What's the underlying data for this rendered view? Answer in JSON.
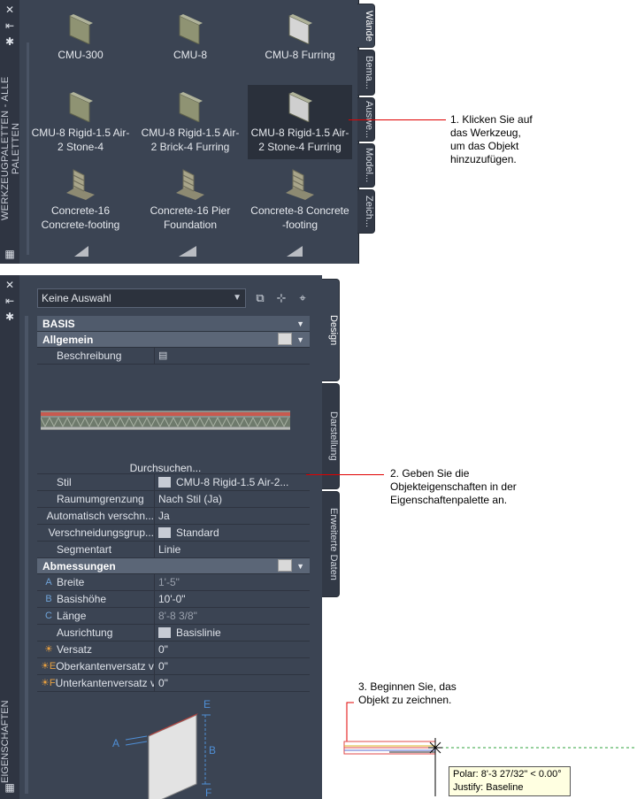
{
  "tool_palette": {
    "vertical_title": "WERKZEUGPALETTEN - ALLE PALETTEN",
    "tools": [
      {
        "label": "CMU-300"
      },
      {
        "label": "CMU-8"
      },
      {
        "label": "CMU-8 Furring"
      },
      {
        "label": "CMU-8 Rigid-1.5 Air-2 Stone-4"
      },
      {
        "label": "CMU-8 Rigid-1.5 Air-2 Brick-4 Furring"
      },
      {
        "label": "CMU-8 Rigid-1.5 Air-2 Stone-4 Furring",
        "selected": true
      },
      {
        "label": "Concrete-16 Concrete-footing"
      },
      {
        "label": "Concrete-16 Pier Foundation"
      },
      {
        "label": "Concrete-8 Concrete -footing"
      }
    ],
    "tabs": [
      "Wände",
      "Bema...",
      "Auswe...",
      "Model...",
      "Zeich..."
    ]
  },
  "properties_palette": {
    "vertical_title": "EIGENSCHAFTEN",
    "selection": "Keine Auswahl",
    "section_basis": "BASIS",
    "section_allgemein": "Allgemein",
    "beschreibung_label": "Beschreibung",
    "browse_label": "Durchsuchen...",
    "allgemein_rows": [
      {
        "key": "Stil",
        "value": "CMU-8 Rigid-1.5 Air-2..."
      },
      {
        "key": "Raumumgrenzung",
        "value": "Nach Stil (Ja)"
      },
      {
        "key": "Automatisch verschn...",
        "value": "Ja"
      },
      {
        "key": "Verschneidungsgrup...",
        "value": "Standard"
      },
      {
        "key": "Segmentart",
        "value": "Linie"
      }
    ],
    "section_abmessungen": "Abmessungen",
    "abmessungen_rows": [
      {
        "letter": "A",
        "key": "Breite",
        "value": "1'-5\"",
        "dim": true
      },
      {
        "letter": "B",
        "key": "Basishöhe",
        "value": "10'-0\"",
        "dim": false
      },
      {
        "letter": "C",
        "key": "Länge",
        "value": "8'-8 3/8\"",
        "dim": true
      },
      {
        "letter": "",
        "key": "Ausrichtung",
        "value": "Basislinie",
        "dim": false
      },
      {
        "letter": "☀",
        "key": "Versatz",
        "value": "0\"",
        "dim": false
      },
      {
        "letter": "☀E",
        "key": "Oberkantenversatz v...",
        "value": "0\"",
        "dim": false
      },
      {
        "letter": "☀F",
        "key": "Unterkantenversatz v...",
        "value": "0\"",
        "dim": false
      }
    ],
    "diagram_labels": {
      "a": "A",
      "b": "B",
      "e": "E",
      "f": "F"
    },
    "tabs": [
      "Design",
      "Darstellung",
      "Erweiterte Daten"
    ]
  },
  "callouts": {
    "step1": [
      "1. Klicken Sie auf",
      "das Werkzeug,",
      "um das Objekt",
      "hinzuzufügen."
    ],
    "step2": [
      "2. Geben Sie die",
      "Objekteigenschaften in der",
      "Eigenschaftenpalette an."
    ],
    "step3": [
      "3. Beginnen Sie, das",
      "Objekt zu zeichnen."
    ]
  },
  "drawing": {
    "tooltip_polar": "Polar: 8'-3 27/32\" < 0.00°",
    "tooltip_justify": "Justify: Baseline"
  },
  "colors": {
    "palette_bg": "#3b4453",
    "leader_red": "#e00000",
    "tooltip_bg": "#ffffe1"
  }
}
